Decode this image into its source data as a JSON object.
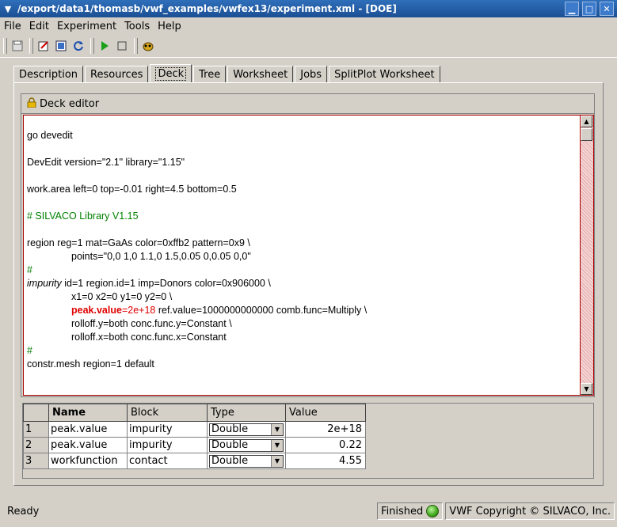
{
  "window": {
    "title": "/export/data1/thomasb/vwf_examples/vwfex13/experiment.xml - [DOE]",
    "min_icon": "minimize-icon",
    "max_icon": "maximize-icon",
    "close_icon": "close-icon"
  },
  "menu": [
    "File",
    "Edit",
    "Experiment",
    "Tools",
    "Help"
  ],
  "tabs": [
    "Description",
    "Resources",
    "Deck",
    "Tree",
    "Worksheet",
    "Jobs",
    "SplitPlot Worksheet"
  ],
  "active_tab": "Deck",
  "editor": {
    "header": "Deck editor",
    "lines": {
      "l1": "go devedit",
      "l2": "DevEdit version=\"2.1\" library=\"1.15\"",
      "l3": "work.area left=0 top=-0.01 right=4.5 bottom=0.5",
      "l4": "# SILVACO Library V1.15",
      "l5": "region reg=1 mat=GaAs color=0xffb2 pattern=0x9 \\",
      "l6": "points=\"0,0 1,0 1.1,0 1.5,0.05 0,0.05 0,0\"",
      "l7": "#",
      "l8a": "impurity",
      "l8b": " id=1 region.id=1 imp=Donors color=0x906000 \\",
      "l9": "x1=0 x2=0 y1=0 y2=0 \\",
      "l10a": "peak.value",
      "l10b": "=2e+18",
      "l10c": " ref.value=1000000000000 comb.func=Multiply \\",
      "l11": "rolloff.y=both conc.func.y=Constant \\",
      "l12": "rolloff.x=both conc.func.x=Constant",
      "l13": "#",
      "l14": "constr.mesh region=1 default"
    }
  },
  "table": {
    "headers": [
      "Name",
      "Block",
      "Type",
      "Value"
    ],
    "rows": [
      {
        "num": "1",
        "name": "peak.value",
        "block": "impurity",
        "type": "Double",
        "value": "2e+18"
      },
      {
        "num": "2",
        "name": "peak.value",
        "block": "impurity",
        "type": "Double",
        "value": "0.22"
      },
      {
        "num": "3",
        "name": "workfunction",
        "block": "contact",
        "type": "Double",
        "value": "4.55"
      }
    ]
  },
  "status": {
    "left": "Ready",
    "state": "Finished",
    "copyright": "VWF Copyright ©  SILVACO, Inc."
  }
}
